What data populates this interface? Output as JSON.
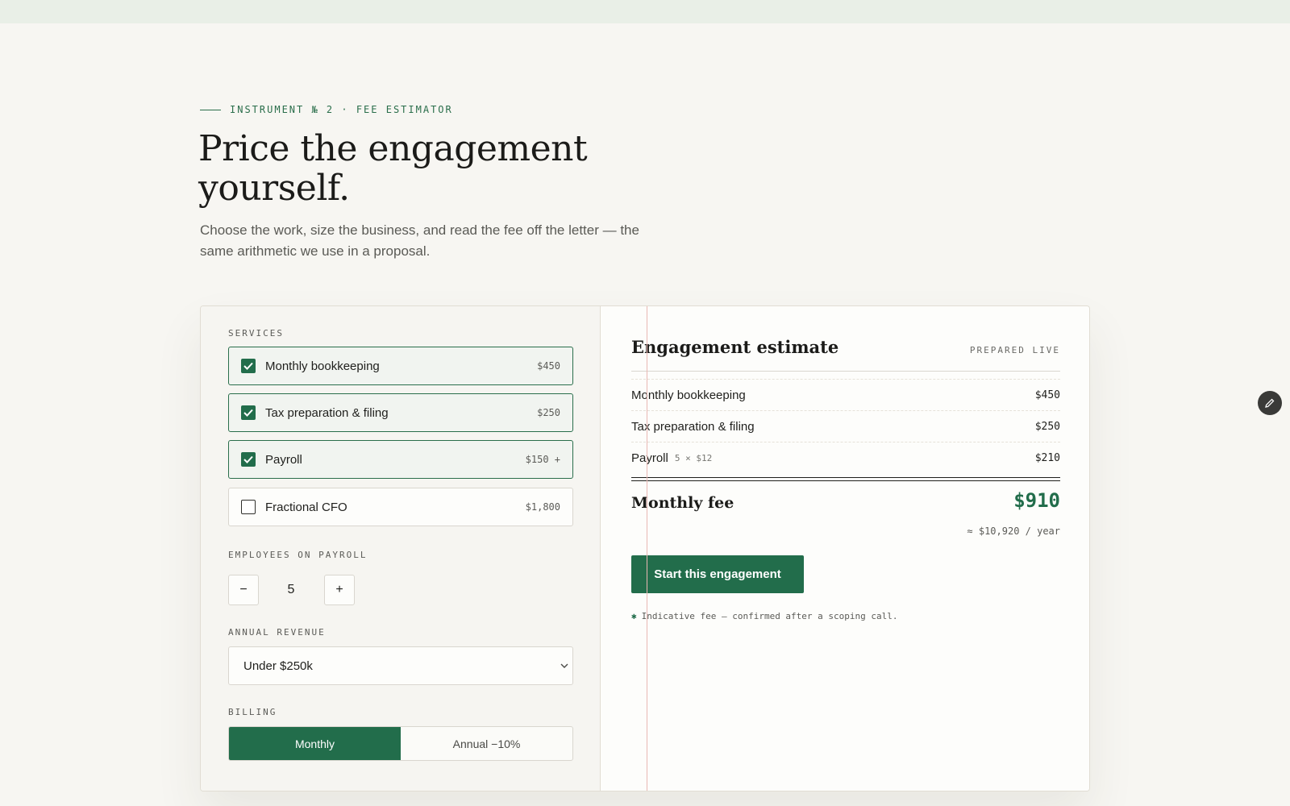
{
  "header": {
    "eyebrow": "INSTRUMENT № 2 · FEE ESTIMATOR",
    "title": "Price the engagement yourself.",
    "lead": "Choose the work, size the business, and read the fee off the letter — the same arithmetic we use in a proposal."
  },
  "form": {
    "services_label": "SERVICES",
    "services": [
      {
        "name": "Monthly bookkeeping",
        "price": "$450",
        "checked": true
      },
      {
        "name": "Tax preparation & filing",
        "price": "$250",
        "checked": true
      },
      {
        "name": "Payroll",
        "price": "$150 +",
        "checked": true
      },
      {
        "name": "Fractional CFO",
        "price": "$1,800",
        "checked": false
      }
    ],
    "employees_label": "EMPLOYEES ON PAYROLL",
    "employees_value": "5",
    "decrement_label": "−",
    "increment_label": "+",
    "revenue_label": "ANNUAL REVENUE",
    "revenue_value": "Under $250k",
    "billing_label": "BILLING",
    "billing_options": [
      "Monthly",
      "Annual −10%"
    ],
    "billing_selected": "Monthly"
  },
  "estimate": {
    "title": "Engagement estimate",
    "badge": "PREPARED LIVE",
    "lines": [
      {
        "name": "Monthly bookkeeping",
        "sub": "",
        "amount": "$450"
      },
      {
        "name": "Tax preparation & filing",
        "sub": "",
        "amount": "$250"
      },
      {
        "name": "Payroll",
        "sub": "5 × $12",
        "amount": "$210"
      }
    ],
    "fee_label": "Monthly fee",
    "fee_amount": "$910",
    "fee_year": "≈ $10,920 / year",
    "cta": "Start this engagement",
    "note_icon": "✱",
    "note": "Indicative fee — confirmed after a scoping call."
  },
  "colors": {
    "accent": "#226d4b",
    "background": "#f7f6f2",
    "margin_line": "#e9b8b4"
  },
  "icons": {
    "checkbox": "check-icon",
    "select": "chevron-down-icon",
    "fab": "pencil-icon"
  }
}
